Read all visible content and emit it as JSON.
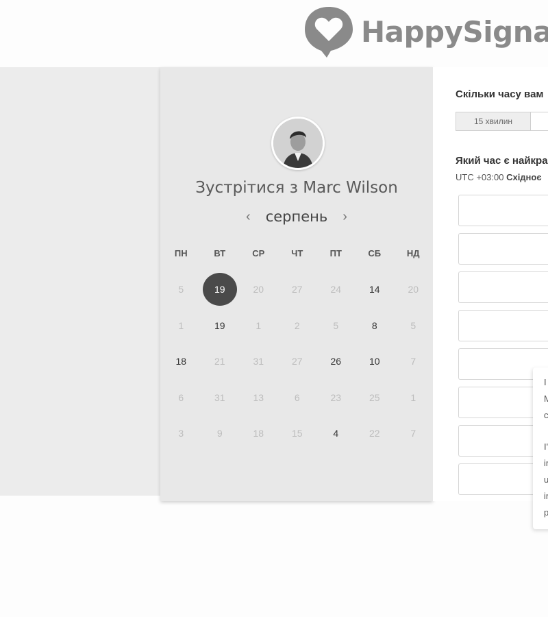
{
  "brand": {
    "name": "HappySignal",
    "icon": "heart-speech-bubble-icon"
  },
  "calendar": {
    "host_avatar": "host-photo",
    "title": "Зустрітися з Marc Wilson",
    "month": "серпень",
    "prev_icon": "chevron-left-icon",
    "next_icon": "chevron-right-icon",
    "weekdays": [
      "ПН",
      "ВТ",
      "СР",
      "ЧТ",
      "ПТ",
      "СБ",
      "НД"
    ],
    "weeks": [
      [
        {
          "d": "5",
          "s": "dis"
        },
        {
          "d": "19",
          "s": "sel"
        },
        {
          "d": "20",
          "s": "dis"
        },
        {
          "d": "27",
          "s": "dis"
        },
        {
          "d": "24",
          "s": "dis"
        },
        {
          "d": "14",
          "s": "av"
        },
        {
          "d": "20",
          "s": "dis"
        }
      ],
      [
        {
          "d": "1",
          "s": "dis"
        },
        {
          "d": "19",
          "s": "av"
        },
        {
          "d": "1",
          "s": "dis"
        },
        {
          "d": "2",
          "s": "dis"
        },
        {
          "d": "5",
          "s": "dis"
        },
        {
          "d": "8",
          "s": "av"
        },
        {
          "d": "5",
          "s": "dis"
        }
      ],
      [
        {
          "d": "18",
          "s": "av"
        },
        {
          "d": "21",
          "s": "dis"
        },
        {
          "d": "31",
          "s": "dis"
        },
        {
          "d": "27",
          "s": "dis"
        },
        {
          "d": "26",
          "s": "av"
        },
        {
          "d": "10",
          "s": "av"
        },
        {
          "d": "7",
          "s": "dis"
        }
      ],
      [
        {
          "d": "6",
          "s": "dis"
        },
        {
          "d": "31",
          "s": "dis"
        },
        {
          "d": "13",
          "s": "dis"
        },
        {
          "d": "6",
          "s": "dis"
        },
        {
          "d": "23",
          "s": "dis"
        },
        {
          "d": "25",
          "s": "dis"
        },
        {
          "d": "1",
          "s": "dis"
        }
      ],
      [
        {
          "d": "3",
          "s": "dis"
        },
        {
          "d": "9",
          "s": "dis"
        },
        {
          "d": "18",
          "s": "dis"
        },
        {
          "d": "15",
          "s": "dis"
        },
        {
          "d": "4",
          "s": "av"
        },
        {
          "d": "22",
          "s": "dis"
        },
        {
          "d": "7",
          "s": "dis"
        }
      ]
    ]
  },
  "booking": {
    "duration_question": "Скільки часу вам",
    "durations": [
      "15 хвилин",
      ""
    ],
    "time_question": "Який час є найкращ",
    "timezone_offset": "UTC +03:00",
    "timezone_name": "Східноє",
    "slot_count": 8
  },
  "chat": {
    "lines": [
      "I",
      "M",
      "c",
      "",
      "I'",
      "ir",
      "u",
      "ir",
      "p"
    ]
  }
}
